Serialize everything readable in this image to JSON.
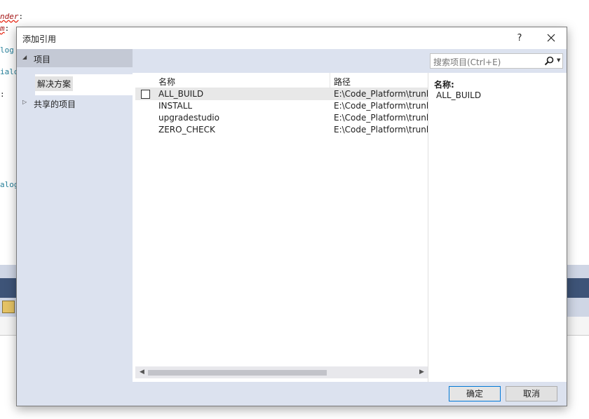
{
  "editor_bg": {
    "lines": [
      {
        "text": "nder",
        "suffix": ":",
        "style": "red"
      },
      {
        "text": "m",
        "suffix": ":",
        "style": "red"
      },
      {
        "text": "log",
        "suffix": "",
        "style": "teal"
      },
      {
        "text": "ialo",
        "suffix": "",
        "style": "teal"
      },
      {
        "text": ":",
        "suffix": "",
        "style": "dark"
      },
      {
        "text": "alog",
        "suffix": "",
        "style": "teal"
      }
    ]
  },
  "dialog": {
    "title": "添加引用",
    "help": "?",
    "left_panel": {
      "node_projects": {
        "arrow": "◢",
        "label": "项目"
      },
      "child_solution": {
        "label": "解决方案"
      },
      "node_shared": {
        "arrow": "▷",
        "label": "共享的项目"
      }
    },
    "search": {
      "placeholder": "搜索项目(Ctrl+E)"
    },
    "list": {
      "headers": {
        "name": "名称",
        "path": "路径"
      },
      "rows": [
        {
          "name": "ALL_BUILD",
          "path": "E:\\Code_Platform\\trunk"
        },
        {
          "name": "INSTALL",
          "path": "E:\\Code_Platform\\trunk"
        },
        {
          "name": "upgradestudio",
          "path": "E:\\Code_Platform\\trunk"
        },
        {
          "name": "ZERO_CHECK",
          "path": "E:\\Code_Platform\\trunk"
        }
      ]
    },
    "detail": {
      "label": "名称:",
      "value": "ALL_BUILD"
    },
    "buttons": {
      "ok": "确定",
      "cancel": "取消"
    }
  },
  "colors": {
    "panel": "#dce2ef",
    "selected": "#c4c9d5",
    "accent": "#0078d7"
  }
}
